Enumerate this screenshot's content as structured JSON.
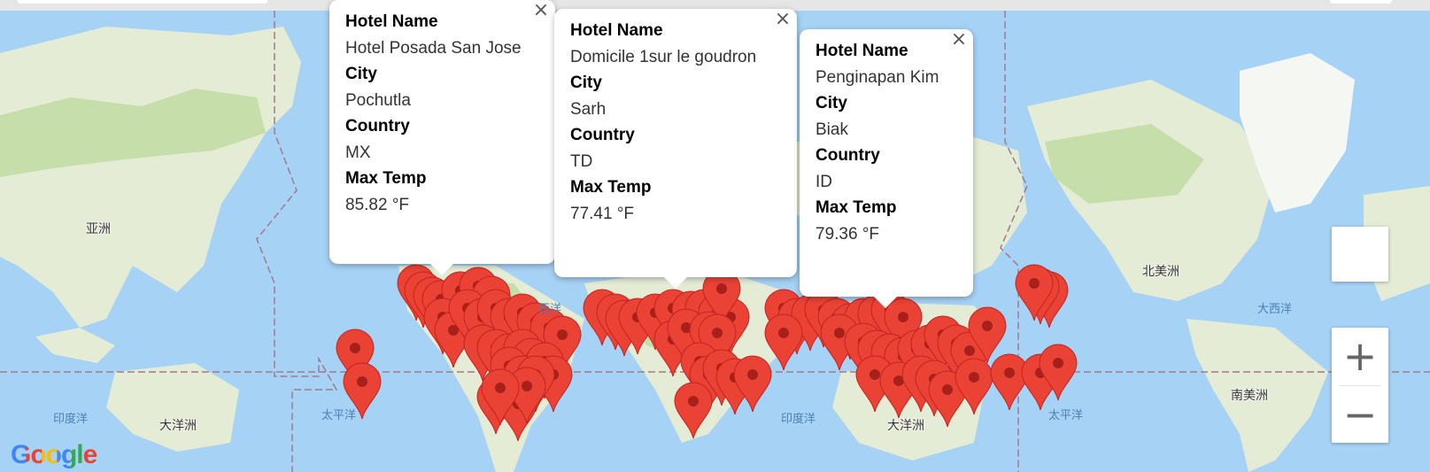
{
  "map": {
    "continents": [
      {
        "key": "asia",
        "label": "亚洲"
      },
      {
        "key": "north_america",
        "label": "北美洲"
      },
      {
        "key": "south_america",
        "label": "南美洲"
      },
      {
        "key": "oceania_left",
        "label": "大洋洲"
      },
      {
        "key": "oceania_center",
        "label": "大洋洲"
      }
    ],
    "oceans": [
      {
        "key": "indian_left",
        "label": "印度洋"
      },
      {
        "key": "pacific_left",
        "label": "太平洋"
      },
      {
        "key": "atlantic_partial",
        "label": "西洋"
      },
      {
        "key": "indian_center",
        "label": "印度洋"
      },
      {
        "key": "pacific_right",
        "label": "太平洋"
      },
      {
        "key": "atlantic_right",
        "label": "大西洋"
      }
    ],
    "logo_text": "Google",
    "colors": {
      "ocean": "#a6d2f5",
      "land": "#e4ecd6",
      "forest": "#c6deaa",
      "marker": "#ea4335",
      "marker_dot": "#a8201a"
    }
  },
  "popups": [
    {
      "hotel_label": "Hotel Name",
      "hotel": "Hotel Posada San Jose",
      "city_label": "City",
      "city": "Pochutla",
      "country_label": "Country",
      "country": "MX",
      "temp_label": "Max Temp",
      "temp": "85.82 °F"
    },
    {
      "hotel_label": "Hotel Name",
      "hotel": "Domicile 1sur le goudron",
      "city_label": "City",
      "city": "Sarh",
      "country_label": "Country",
      "country": "TD",
      "temp_label": "Max Temp",
      "temp": "77.41 °F"
    },
    {
      "hotel_label": "Hotel Name",
      "hotel": "Penginapan Kim",
      "city_label": "City",
      "city": "Biak",
      "country_label": "Country",
      "country": "ID",
      "temp_label": "Max Temp",
      "temp": "79.36 °F"
    }
  ],
  "controls": {
    "close_icon": "×",
    "zoom_in": "+",
    "zoom_out": "−"
  }
}
